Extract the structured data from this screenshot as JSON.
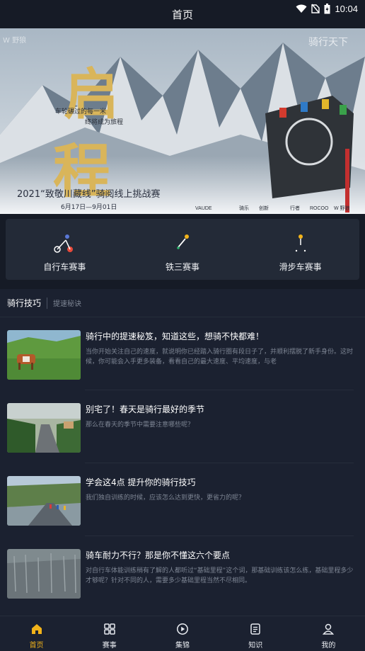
{
  "status_bar": {
    "time": "10:04"
  },
  "header": {
    "title": "首页"
  },
  "banner": {
    "headline": "启程",
    "slogan_line1": "车轮碾过的每一米",
    "slogan_line2": "终将成为旅程",
    "event_title": "2021“致敬川藏线”骑阅线上挑战赛",
    "dates": "6月17日—9月01日",
    "watermark": "W 野狼",
    "top_right_mark": "骑行天下",
    "sponsors": [
      "VAUDE",
      "骑乐",
      "创新",
      "行者",
      "ROCOO",
      "W 野狼"
    ]
  },
  "categories": [
    {
      "label": "自行车赛事",
      "icon": "bicycle-icon"
    },
    {
      "label": "铁三赛事",
      "icon": "triathlon-icon"
    },
    {
      "label": "滑步车赛事",
      "icon": "balance-bike-icon"
    }
  ],
  "tabs": {
    "active": "骑行技巧",
    "inactive": "提速秘诀"
  },
  "articles": [
    {
      "title": "骑行中的提速秘笈，知道这些，想骑不快都难！",
      "desc": "当你开始关注自己的速度，就说明你已经踏入骑行圈有段日子了，并顺利摆脱了新手身份。这时候，你可能会入手更多装备，看看自己的最大速度、平均速度，与老"
    },
    {
      "title": "别宅了！春天是骑行最好的季节",
      "desc": "那么在春天的季节中需要注意哪些呢？"
    },
    {
      "title": "学会这4点 提升你的骑行技巧",
      "desc": "我们独自训练的时候，应该怎么达到更快，更省力的呢？"
    },
    {
      "title": "骑车耐力不行？那是你不懂这六个要点",
      "desc": "对自行车体能训练稍有了解的人都听过“基础里程”这个词，那基础训练该怎么练，基础里程多少才够呢？针对不同的人，需要多少基础里程当然不尽相同。"
    }
  ],
  "tabbar": [
    {
      "label": "首页",
      "icon": "home-icon",
      "active": true
    },
    {
      "label": "赛事",
      "icon": "grid-icon",
      "active": false
    },
    {
      "label": "集锦",
      "icon": "play-icon",
      "active": false
    },
    {
      "label": "知识",
      "icon": "document-icon",
      "active": false
    },
    {
      "label": "我的",
      "icon": "user-icon",
      "active": false
    }
  ],
  "colors": {
    "accent": "#f2b31a",
    "background": "#161b26",
    "card": "#232a37"
  }
}
